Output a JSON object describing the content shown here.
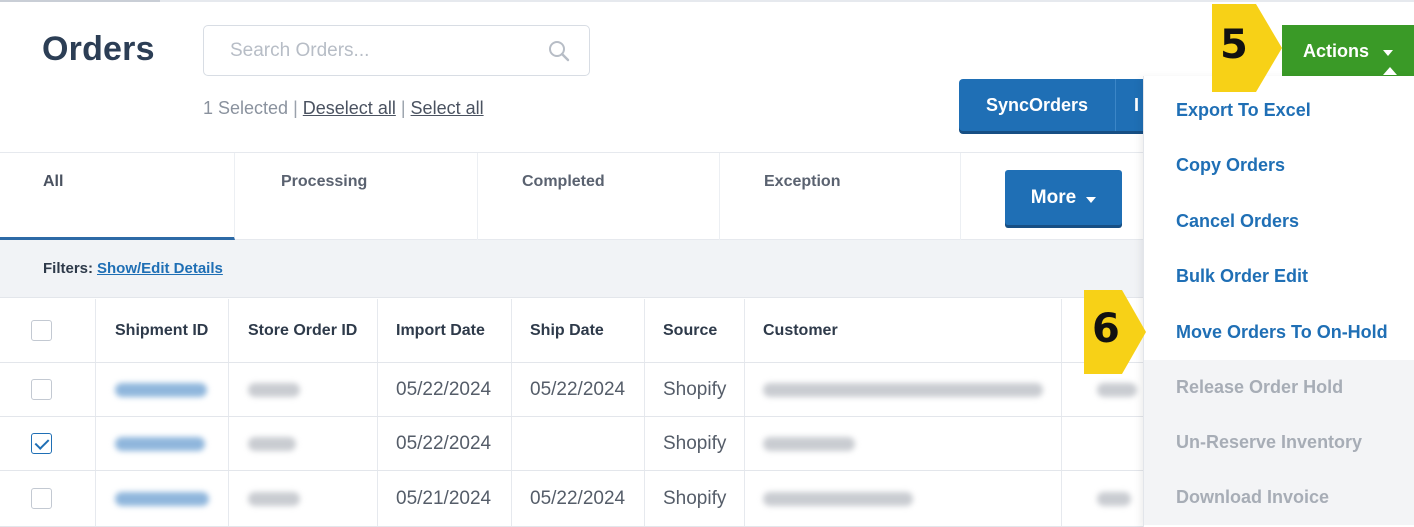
{
  "header": {
    "title": "Orders",
    "search_placeholder": "Search Orders...",
    "search_value": ""
  },
  "selection": {
    "selected_text": "1 Selected",
    "sep1": "|",
    "deselect_all": "Deselect all",
    "sep2": "|",
    "select_all": "Select all"
  },
  "toolbar": {
    "sync_label": "SyncOrders",
    "import_label": "I",
    "actions_label": "Actions",
    "more_label": "More"
  },
  "tabs": [
    {
      "label": "All",
      "active": true
    },
    {
      "label": "Processing",
      "active": false
    },
    {
      "label": "Completed",
      "active": false
    },
    {
      "label": "Exception",
      "active": false
    }
  ],
  "filters": {
    "label": "Filters:",
    "link": "Show/Edit Details"
  },
  "table": {
    "columns": [
      "Shipment ID",
      "Store Order ID",
      "Import Date",
      "Ship Date",
      "Source",
      "Customer"
    ],
    "rows": [
      {
        "checked": false,
        "import_date": "05/22/2024",
        "ship_date": "05/22/2024",
        "source": "Shopify"
      },
      {
        "checked": true,
        "import_date": "05/22/2024",
        "ship_date": "",
        "source": "Shopify"
      },
      {
        "checked": false,
        "import_date": "05/21/2024",
        "ship_date": "05/22/2024",
        "source": "Shopify"
      }
    ]
  },
  "actions_menu": {
    "items": [
      {
        "label": "Export To Excel",
        "enabled": true
      },
      {
        "label": "Copy Orders",
        "enabled": true
      },
      {
        "label": "Cancel Orders",
        "enabled": true
      },
      {
        "label": "Bulk Order Edit",
        "enabled": true
      },
      {
        "label": "Move Orders To On-Hold",
        "enabled": true
      },
      {
        "label": "Release Order Hold",
        "enabled": false
      },
      {
        "label": "Un-Reserve Inventory",
        "enabled": false
      },
      {
        "label": "Download Invoice",
        "enabled": false
      }
    ]
  },
  "annotations": {
    "step5": "5",
    "step6": "6"
  },
  "colors": {
    "primary_blue": "#1f6fb5",
    "actions_green": "#3a9a27",
    "marker_yellow": "#f7d117",
    "title_text": "#2c3e55"
  },
  "icons": {
    "search": "search-icon",
    "caret": "chevron-down-icon",
    "check": "checkmark-icon"
  }
}
